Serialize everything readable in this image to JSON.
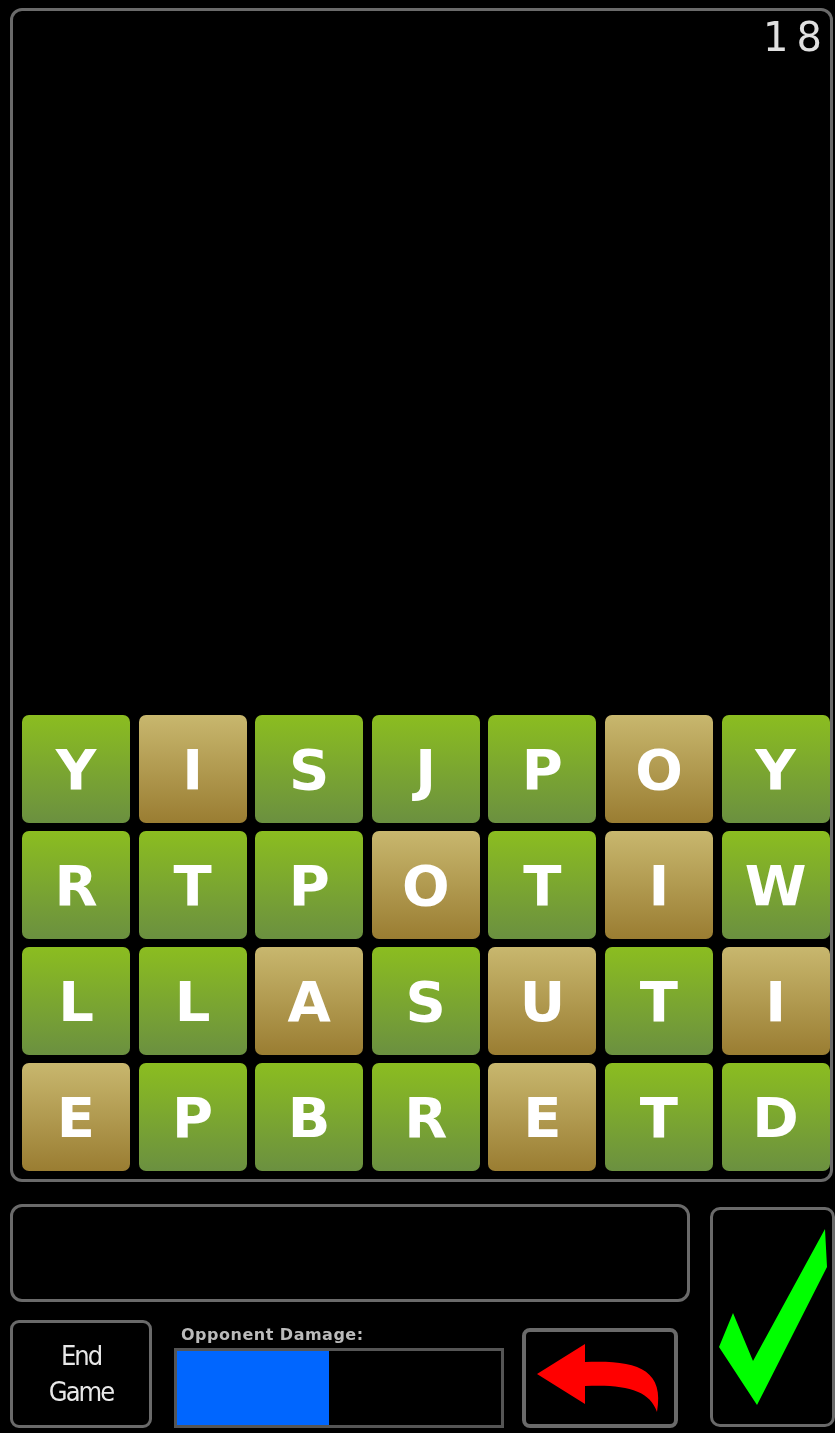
{
  "score": "18",
  "tiles": [
    [
      {
        "letter": "Y",
        "kind": "normal"
      },
      {
        "letter": "I",
        "kind": "bonus"
      },
      {
        "letter": "S",
        "kind": "normal"
      },
      {
        "letter": "J",
        "kind": "normal"
      },
      {
        "letter": "P",
        "kind": "normal"
      },
      {
        "letter": "O",
        "kind": "bonus"
      },
      {
        "letter": "Y",
        "kind": "normal"
      }
    ],
    [
      {
        "letter": "R",
        "kind": "normal"
      },
      {
        "letter": "T",
        "kind": "normal"
      },
      {
        "letter": "P",
        "kind": "normal"
      },
      {
        "letter": "O",
        "kind": "bonus"
      },
      {
        "letter": "T",
        "kind": "normal"
      },
      {
        "letter": "I",
        "kind": "bonus"
      },
      {
        "letter": "W",
        "kind": "normal"
      }
    ],
    [
      {
        "letter": "L",
        "kind": "normal"
      },
      {
        "letter": "L",
        "kind": "normal"
      },
      {
        "letter": "A",
        "kind": "bonus"
      },
      {
        "letter": "S",
        "kind": "normal"
      },
      {
        "letter": "U",
        "kind": "bonus"
      },
      {
        "letter": "T",
        "kind": "normal"
      },
      {
        "letter": "I",
        "kind": "bonus"
      }
    ],
    [
      {
        "letter": "E",
        "kind": "bonus"
      },
      {
        "letter": "P",
        "kind": "normal"
      },
      {
        "letter": "B",
        "kind": "normal"
      },
      {
        "letter": "R",
        "kind": "normal"
      },
      {
        "letter": "E",
        "kind": "bonus"
      },
      {
        "letter": "T",
        "kind": "normal"
      },
      {
        "letter": "D",
        "kind": "normal"
      }
    ]
  ],
  "end_button": {
    "label": "End Game"
  },
  "damage": {
    "label": "Opponent Damage:",
    "level": 0.47
  }
}
